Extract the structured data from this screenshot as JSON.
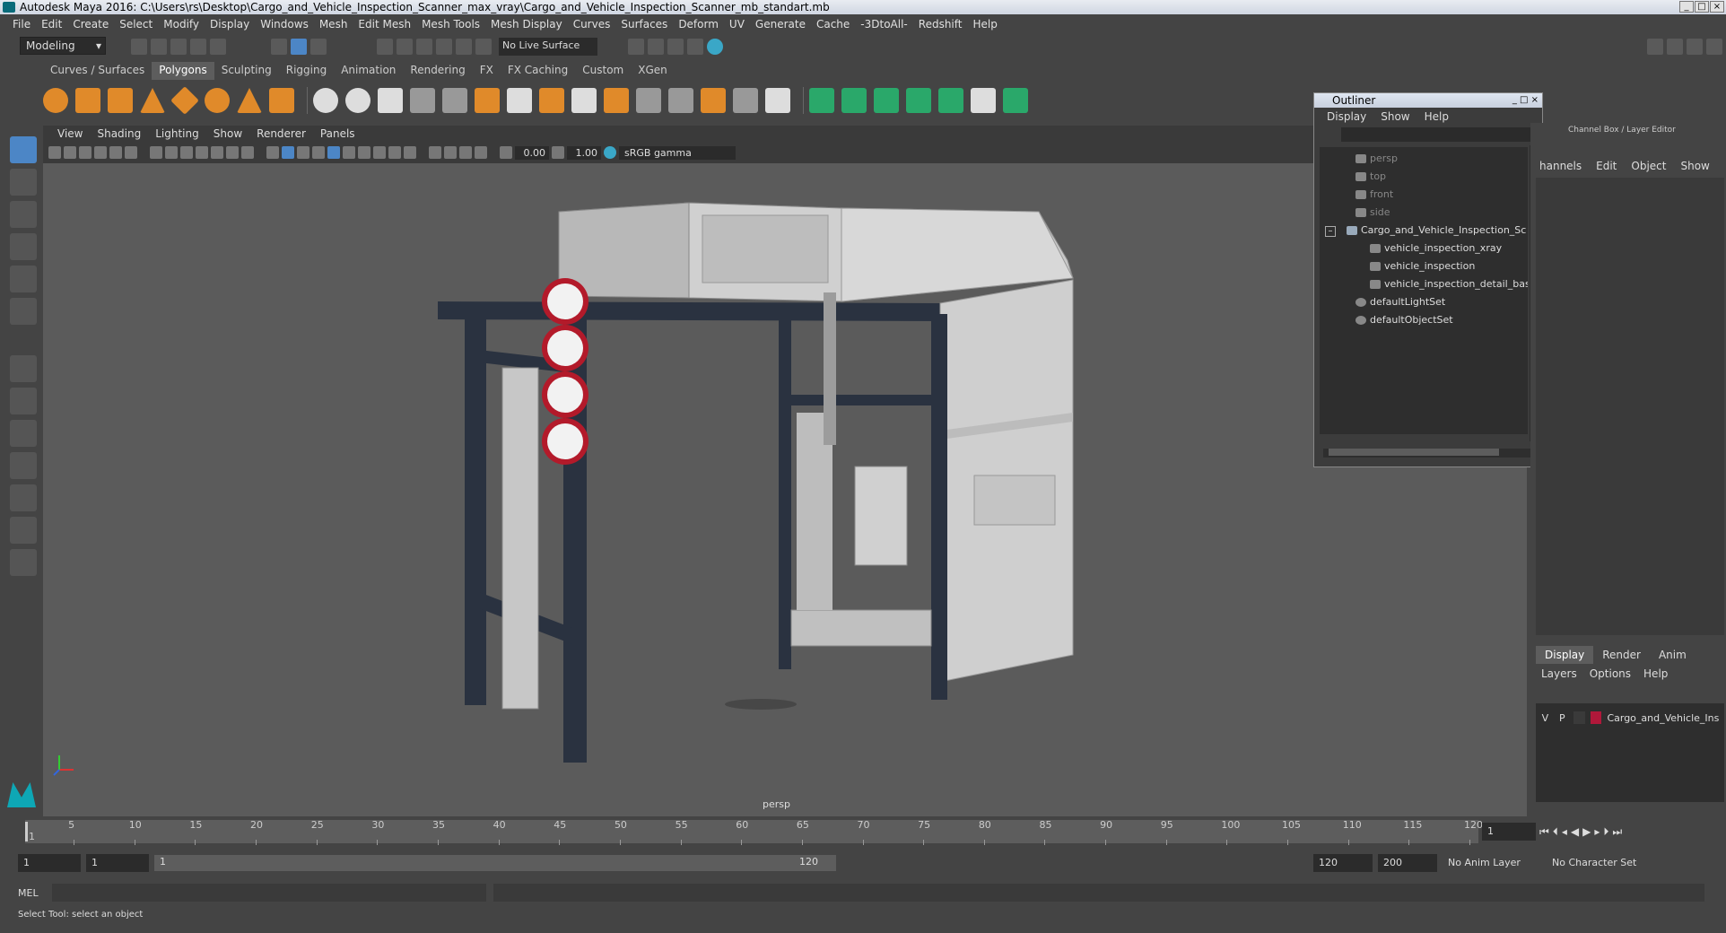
{
  "window": {
    "title": "Autodesk Maya 2016: C:\\Users\\rs\\Desktop\\Cargo_and_Vehicle_Inspection_Scanner_max_vray\\Cargo_and_Vehicle_Inspection_Scanner_mb_standart.mb"
  },
  "menubar": [
    "File",
    "Edit",
    "Create",
    "Select",
    "Modify",
    "Display",
    "Windows",
    "Mesh",
    "Edit Mesh",
    "Mesh Tools",
    "Mesh Display",
    "Curves",
    "Surfaces",
    "Deform",
    "UV",
    "Generate",
    "Cache",
    "-3DtoAll-",
    "Redshift",
    "Help"
  ],
  "statusline": {
    "mode": "Modeling",
    "live_surface": "No Live Surface"
  },
  "shelf_tabs": [
    "Curves / Surfaces",
    "Polygons",
    "Sculpting",
    "Rigging",
    "Animation",
    "Rendering",
    "FX",
    "FX Caching",
    "Custom",
    "XGen"
  ],
  "shelf_active": "Polygons",
  "viewport": {
    "menu": [
      "View",
      "Shading",
      "Lighting",
      "Show",
      "Renderer",
      "Panels"
    ],
    "exposure": "0.00",
    "gamma": "1.00",
    "color_space": "sRGB gamma",
    "camera": "persp"
  },
  "outliner": {
    "title": "Outliner",
    "menu": [
      "Display",
      "Show",
      "Help"
    ],
    "items": [
      {
        "label": "persp",
        "dim": true
      },
      {
        "label": "top",
        "dim": true
      },
      {
        "label": "front",
        "dim": true
      },
      {
        "label": "side",
        "dim": true
      },
      {
        "label": "Cargo_and_Vehicle_Inspection_Sc",
        "dim": false
      },
      {
        "label": "vehicle_inspection_xray",
        "dim": false
      },
      {
        "label": "vehicle_inspection",
        "dim": false
      },
      {
        "label": "vehicle_inspection_detail_bas",
        "dim": false
      },
      {
        "label": "defaultLightSet",
        "dim": false
      },
      {
        "label": "defaultObjectSet",
        "dim": false
      }
    ]
  },
  "channel_box": {
    "title": "Channel Box / Layer Editor",
    "menu": [
      "hannels",
      "Edit",
      "Object",
      "Show"
    ]
  },
  "layer_editor": {
    "tabs": [
      "Display",
      "Render",
      "Anim"
    ],
    "active_tab": "Display",
    "menu": [
      "Layers",
      "Options",
      "Help"
    ],
    "layer": {
      "v": "V",
      "p": "P",
      "name": "Cargo_and_Vehicle_Ins",
      "color": "#b0183a"
    }
  },
  "timeline": {
    "ticks": [
      "5",
      "10",
      "15",
      "20",
      "25",
      "30",
      "35",
      "40",
      "45",
      "50",
      "55",
      "60",
      "65",
      "70",
      "75",
      "80",
      "85",
      "90",
      "95",
      "100",
      "105",
      "110",
      "115",
      "120"
    ],
    "start_label": "1",
    "current_frame": "1"
  },
  "range": {
    "start": "1",
    "playback_start": "1",
    "slider_start": "1",
    "slider_end": "120",
    "playback_end": "120",
    "end": "200",
    "anim_layer": "No Anim Layer",
    "character_set": "No Character Set"
  },
  "cmdline": {
    "label": "MEL"
  },
  "helpline": {
    "text": "Select Tool: select an object"
  },
  "colors": {
    "accent": "#5d5d5d",
    "layer_red": "#b0183a"
  }
}
